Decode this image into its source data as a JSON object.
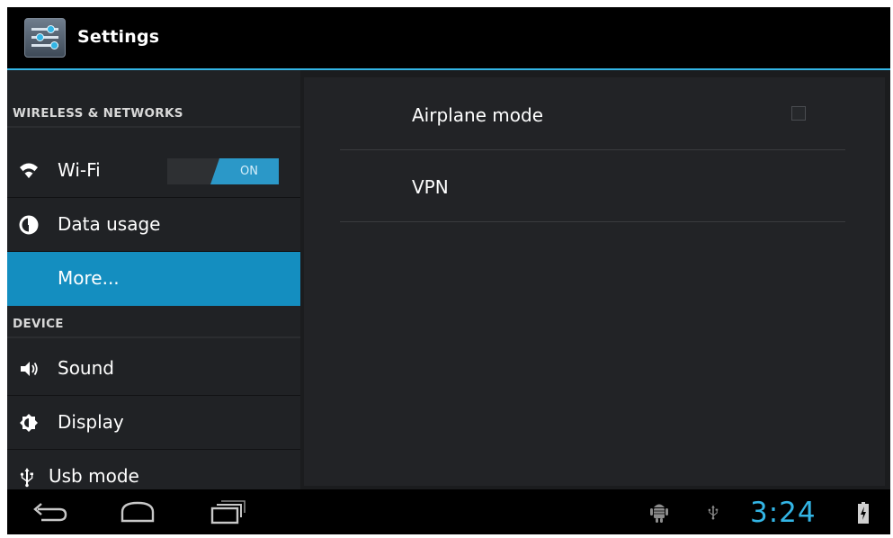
{
  "action_bar": {
    "title": "Settings",
    "icon": "settings-icon"
  },
  "sidebar": {
    "sections": [
      {
        "header": "WIRELESS & NETWORKS"
      },
      {
        "header": "DEVICE"
      }
    ],
    "items": [
      {
        "label": "Wi-Fi",
        "icon": "wifi-icon",
        "toggle": "ON"
      },
      {
        "label": "Data usage",
        "icon": "data-usage-icon"
      },
      {
        "label": "More...",
        "selected": true
      },
      {
        "label": "Sound",
        "icon": "sound-icon"
      },
      {
        "label": "Display",
        "icon": "display-icon"
      },
      {
        "label": "Usb mode",
        "icon": "usb-icon"
      }
    ]
  },
  "detail": {
    "items": [
      {
        "label": "Airplane mode",
        "checked": false
      },
      {
        "label": "VPN"
      }
    ]
  },
  "system_bar": {
    "clock": "3:24",
    "nav_icons": [
      "back-icon",
      "home-icon",
      "recent-apps-icon"
    ],
    "status_icons": [
      "android-debug-icon",
      "usb-icon",
      "battery-charging-icon"
    ]
  },
  "colors": {
    "accent": "#33b5e5",
    "selected": "#148ec0",
    "background": "#1b1c1e"
  }
}
